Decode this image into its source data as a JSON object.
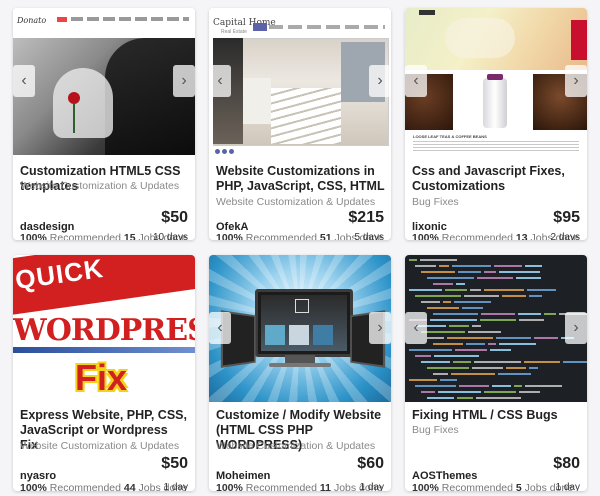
{
  "cards": [
    {
      "title": "Customization HTML5 CSS templates",
      "category": "Website Customization & Updates",
      "seller": "dasdesign",
      "price": "$50",
      "rec_pct": "100%",
      "rec_label": "Recommended",
      "jobs": "15",
      "jobs_label": "Jobs done",
      "days": "10 days",
      "thumb": {
        "logo": "Donato",
        "nav": [
          "Home",
          "About Me",
          "Gallery",
          "Testimonials",
          "Education",
          "Web List",
          "Travel Research",
          "Blog"
        ]
      }
    },
    {
      "title": "Website Customizations in PHP, JavaScript, CSS, HTML",
      "category": "Website Customization & Updates",
      "seller": "OfekA",
      "price": "$215",
      "rec_pct": "100%",
      "rec_label": "Recommended",
      "jobs": "51",
      "jobs_label": "Jobs done",
      "days": "5 days",
      "thumb": {
        "logo": "Capital Home",
        "logo_sub": "Real Estate",
        "nav": [
          "Home",
          "About",
          "Property",
          "Short Term",
          "Journeys",
          "Contact"
        ]
      }
    },
    {
      "title": "Css and Javascript Fixes, Customizations",
      "category": "Bug Fixes",
      "seller": "lixonic",
      "price": "$95",
      "rec_pct": "100%",
      "rec_label": "Recommended",
      "jobs": "13",
      "jobs_label": "Jobs done",
      "days": "2 days",
      "thumb": {
        "caption": "LOOSE LEAF TEAS & COFFEE BEANS"
      }
    },
    {
      "title": "Express Website, PHP, CSS, JavaScript or Wordpress Fix",
      "category": "Website Customization & Updates",
      "seller": "nyasro",
      "price": "$50",
      "rec_pct": "100%",
      "rec_label": "Recommended",
      "jobs": "44",
      "jobs_label": "Jobs done",
      "days": "1 day",
      "thumb": {
        "word1": "QUICK",
        "word2": "WORDPRESS",
        "word3": "Fix"
      }
    },
    {
      "title": "Customize / Modify Website (HTML CSS PHP WORDPRESS)",
      "category": "Website Customization & Updates",
      "seller": "Moheimen",
      "price": "$60",
      "rec_pct": "100%",
      "rec_label": "Recommended",
      "jobs": "11",
      "jobs_label": "Jobs done",
      "days": "1 day",
      "thumb": {}
    },
    {
      "title": "Fixing HTML / CSS Bugs",
      "category": "Bug Fixes",
      "seller": "AOSThemes",
      "price": "$80",
      "rec_pct": "100%",
      "rec_label": "Recommended",
      "jobs": "5",
      "jobs_label": "Jobs done",
      "days": "1 day",
      "thumb": {}
    }
  ],
  "colors": {
    "code_bg": "#1d2024",
    "wp_red": "#d21f1f",
    "brand_red": "#c8102e"
  }
}
